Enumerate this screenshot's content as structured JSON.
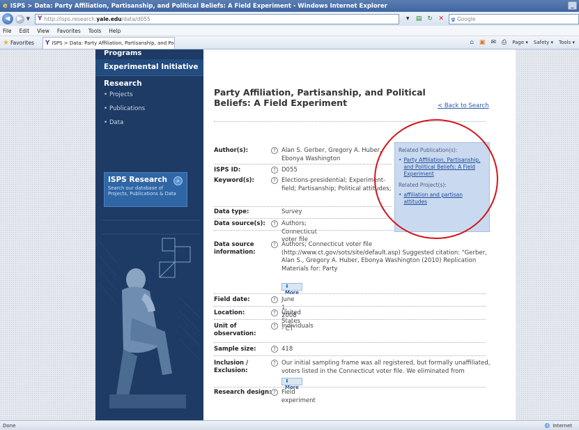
{
  "window": {
    "title": "ISPS > Data: Party Affiliation, Partisanship, and Political Beliefs: A Field Experiment - Windows Internet Explorer",
    "address_prefix": "http://isps.research.",
    "address_site": "yale.edu",
    "address_suffix": "/data/d055",
    "search_placeholder": "Google"
  },
  "menu": [
    "File",
    "Edit",
    "View",
    "Favorites",
    "Tools",
    "Help"
  ],
  "favorites": {
    "label": "Favorites",
    "tab_title": "ISPS > Data: Party Affiliation, Partisanship, and Politic..."
  },
  "command_bar": [
    "Page ▾",
    "Safety ▾",
    "Tools ▾"
  ],
  "sidebar": {
    "programs": "Programs",
    "experimental": "Experimental Initiative",
    "research": "Research",
    "sub_items": [
      "Projects",
      "Publications",
      "Data"
    ],
    "box_heading": "ISPS Research",
    "box_text": "Search our database of Projects, Publications & Data"
  },
  "main": {
    "title": "Party Affiliation, Partisanship, and Political Beliefs: A Field Experiment",
    "back_link": "< Back to Search",
    "more_label": "More",
    "fields": {
      "authors": {
        "label": "Author(s):",
        "value": "Alan S. Gerber, Gregory A. Huber, Ebonya Washington"
      },
      "isps_id": {
        "label": "ISPS ID:",
        "value": "D055"
      },
      "keywords": {
        "label": "Keyword(s):",
        "value": "Elections-presidential; Experiment-field; Partisanship; Political attitudes;"
      },
      "data_type": {
        "label": "Data type:",
        "value": "Survey"
      },
      "data_sources": {
        "label": "Data source(s):",
        "value": "Authors; Connecticut voter file"
      },
      "data_source_info": {
        "label": "Data source information:",
        "value": "Authors; Connecticut voter file (http://www.ct.gov/sots/site/default.asp) Suggested citation: \"Gerber, Alan S., Gregory A. Huber, Ebonya Washington (2010) Replication Materials for: Party"
      },
      "field_date": {
        "label": "Field date:",
        "value": "June 1, 2008"
      },
      "location": {
        "label": "Location:",
        "value": "United States - CT"
      },
      "unit": {
        "label": "Unit of observation:",
        "value": "Individuals"
      },
      "sample_size": {
        "label": "Sample size:",
        "value": "418"
      },
      "inclusion": {
        "label": "Inclusion / Exclusion:",
        "value": "Our initial sampling frame was all registered, but formally unaffiliated, voters listed in the Connecticut voter file. We eliminated from"
      },
      "research_design": {
        "label": "Research design:",
        "value": "Field experiment"
      }
    }
  },
  "related": {
    "publications_heading": "Related Publication(s):",
    "publication": "Party Affiliation, Partisanship, and Political Beliefs: A Field Experiment",
    "projects_heading": "Related Project(s):",
    "project": "affiliation and partisan attitudes"
  },
  "statusbar": {
    "left": "Done",
    "zone": "Internet"
  },
  "colors": {
    "sidebar_bg": "#1d3b64",
    "highlight_circle": "#d4141b",
    "related_box": "#c9d9ef",
    "link": "#2a5aa8"
  }
}
